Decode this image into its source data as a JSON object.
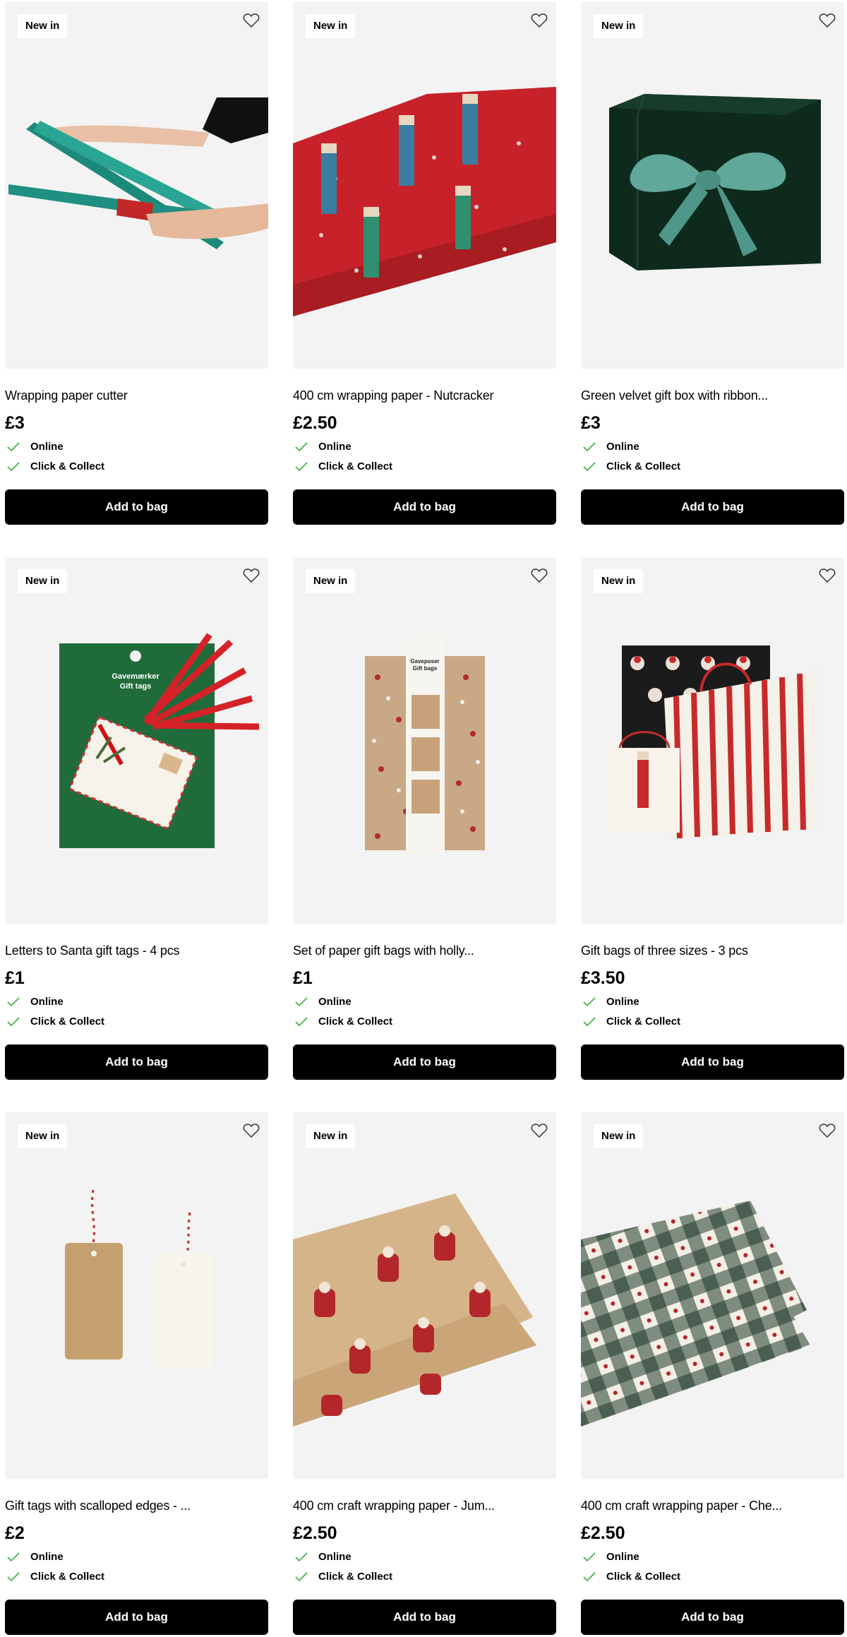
{
  "products": [
    {
      "badge": "New in",
      "title": "Wrapping paper cutter",
      "price": "£3",
      "online_label": "Online",
      "cc_label": "Click & Collect",
      "button_label": "Add to bag",
      "image_icon": "wrapping-paper-cutter-image"
    },
    {
      "badge": "New in",
      "title": "400 cm wrapping paper - Nutcracker",
      "price": "£2.50",
      "online_label": "Online",
      "cc_label": "Click & Collect",
      "button_label": "Add to bag",
      "image_icon": "nutcracker-wrapping-paper-image"
    },
    {
      "badge": "New in",
      "title": "Green velvet gift box with ribbon...",
      "price": "£3",
      "online_label": "Online",
      "cc_label": "Click & Collect",
      "button_label": "Add to bag",
      "image_icon": "green-velvet-gift-box-image"
    },
    {
      "badge": "New in",
      "title": "Letters to Santa gift tags - 4 pcs",
      "price": "£1",
      "online_label": "Online",
      "cc_label": "Click & Collect",
      "button_label": "Add to bag",
      "image_icon": "santa-gift-tags-image"
    },
    {
      "badge": "New in",
      "title": "Set of paper gift bags with holly...",
      "price": "£1",
      "online_label": "Online",
      "cc_label": "Click & Collect",
      "button_label": "Add to bag",
      "image_icon": "holly-paper-gift-bags-image"
    },
    {
      "badge": "New in",
      "title": "Gift bags of three sizes - 3 pcs",
      "price": "£3.50",
      "online_label": "Online",
      "cc_label": "Click & Collect",
      "button_label": "Add to bag",
      "image_icon": "three-gift-bags-image"
    },
    {
      "badge": "New in",
      "title": "Gift tags with scalloped edges - ...",
      "price": "£2",
      "online_label": "Online",
      "cc_label": "Click & Collect",
      "button_label": "Add to bag",
      "image_icon": "scalloped-gift-tags-image"
    },
    {
      "badge": "New in",
      "title": "400 cm craft wrapping paper - Jum...",
      "price": "£2.50",
      "online_label": "Online",
      "cc_label": "Click & Collect",
      "button_label": "Add to bag",
      "image_icon": "santa-craft-wrapping-paper-image"
    },
    {
      "badge": "New in",
      "title": "400 cm craft wrapping paper - Che...",
      "price": "£2.50",
      "online_label": "Online",
      "cc_label": "Click & Collect",
      "button_label": "Add to bag",
      "image_icon": "checkered-craft-wrapping-paper-image"
    }
  ],
  "gift_box_label": {
    "line1": "Gavemærker",
    "line2": "Gift tags"
  },
  "gift_bag_label": {
    "line1": "Gaveposer",
    "line2": "Gift bags"
  },
  "colors": {
    "accent": "#000000",
    "check_green": "#5cb85c",
    "card_bg": "#f3f3f3",
    "button_text": "#ffffff"
  },
  "icons": {
    "favourite": "heart-outline-icon",
    "available": "checkmark-icon"
  }
}
